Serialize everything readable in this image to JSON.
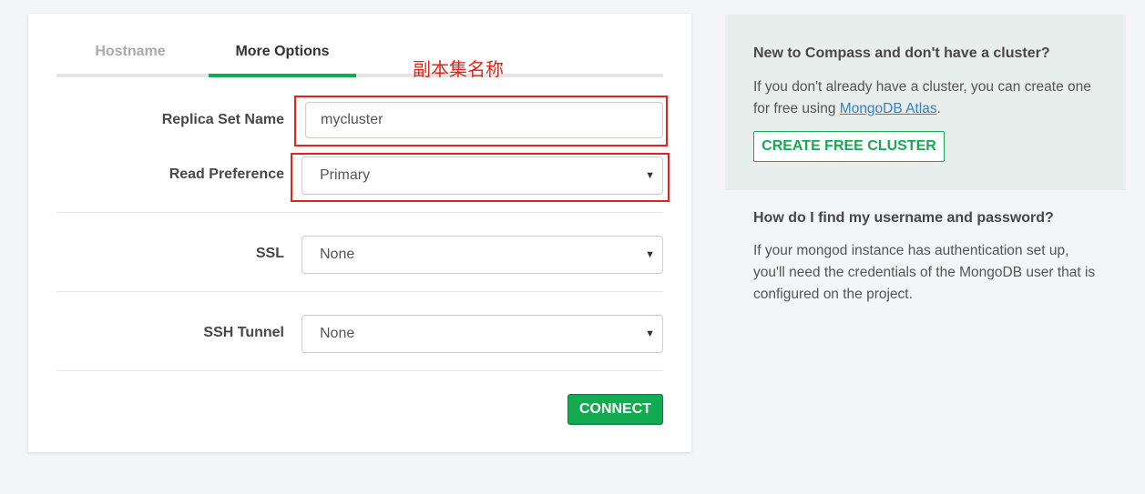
{
  "tabs": [
    {
      "label": "Hostname",
      "active": false
    },
    {
      "label": "More Options",
      "active": true
    }
  ],
  "annotation": {
    "text": "副本集名称",
    "color": "#e2231a"
  },
  "form": {
    "replica_set": {
      "label": "Replica Set Name",
      "value": "mycluster"
    },
    "read_preference": {
      "label": "Read Preference",
      "value": "Primary"
    },
    "ssl": {
      "label": "SSL",
      "value": "None"
    },
    "ssh_tunnel": {
      "label": "SSH Tunnel",
      "value": "None"
    },
    "connect_label": "CONNECT"
  },
  "help": {
    "cluster_title": "New to Compass and don't have a cluster?",
    "cluster_text_before": "If you don't already have a cluster, you can create one for free using ",
    "atlas_link": "MongoDB Atlas",
    "cluster_text_after": ".",
    "create_cluster_label": "CREATE FREE CLUSTER",
    "credentials_title": "How do I find my username and password?",
    "credentials_text": "If your mongod instance has authentication set up, you'll need the credentials of the MongoDB user that is configured on the project."
  },
  "colors": {
    "accent": "#13aa52",
    "link": "#3d7fba",
    "annotation": "#e2231a",
    "panel_bg": "#e7eeec"
  },
  "icons": {
    "select_caret": "caret-down-icon"
  }
}
